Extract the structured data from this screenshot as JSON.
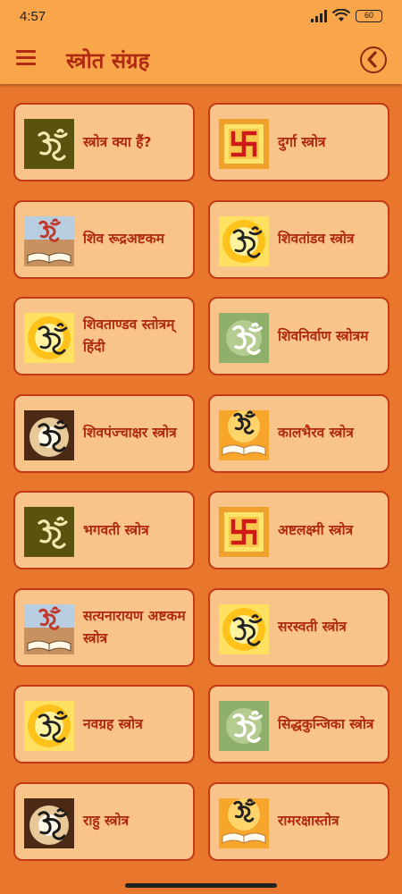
{
  "status": {
    "time": "4:57",
    "battery": "60"
  },
  "header": {
    "title": "स्त्रोत संग्रह"
  },
  "items": [
    {
      "label": "स्त्रोत्र क्या हैं?",
      "icon": "om-olive-icon"
    },
    {
      "label": "दुर्गा स्त्रोत्र",
      "icon": "swastik-icon"
    },
    {
      "label": "शिव रूद्रअष्टकम",
      "icon": "om-book-sky-icon"
    },
    {
      "label": "शिवतांडव स्त्रोत्र",
      "icon": "om-sunburst-icon"
    },
    {
      "label": "शिवताण्डव स्तोत्रम् हिंदी",
      "icon": "om-sunburst-icon"
    },
    {
      "label": "शिवनिर्वाण स्त्रोत्रम",
      "icon": "om-green-icon"
    },
    {
      "label": "शिवपंज्चाक्षर स्त्रोत्र",
      "icon": "om-glow-icon"
    },
    {
      "label": "कालभैरव स्त्रोत्र",
      "icon": "om-book-orange-icon"
    },
    {
      "label": "भगवती स्त्रोत्र",
      "icon": "om-olive-icon"
    },
    {
      "label": "अष्टलक्ष्मी स्त्रोत्र",
      "icon": "swastik-icon"
    },
    {
      "label": "सत्यनारायण अष्टकम स्त्रोत्र",
      "icon": "om-book-sky-icon"
    },
    {
      "label": "सरस्वती स्त्रोत्र",
      "icon": "om-sunburst-icon"
    },
    {
      "label": "नवग्रह स्त्रोत्र",
      "icon": "om-sunburst-icon"
    },
    {
      "label": "सिद्धकुन्जिका स्त्रोत्र",
      "icon": "om-green-icon"
    },
    {
      "label": "राहु स्त्रोत्र",
      "icon": "om-glow-icon"
    },
    {
      "label": "रामरक्षास्तोत्र",
      "icon": "om-book-orange-icon"
    }
  ],
  "colors": {
    "background": "#e8762c",
    "bar": "#f9a64b",
    "card": "#f9c48a",
    "border": "#c33a15",
    "text": "#b02a12"
  }
}
